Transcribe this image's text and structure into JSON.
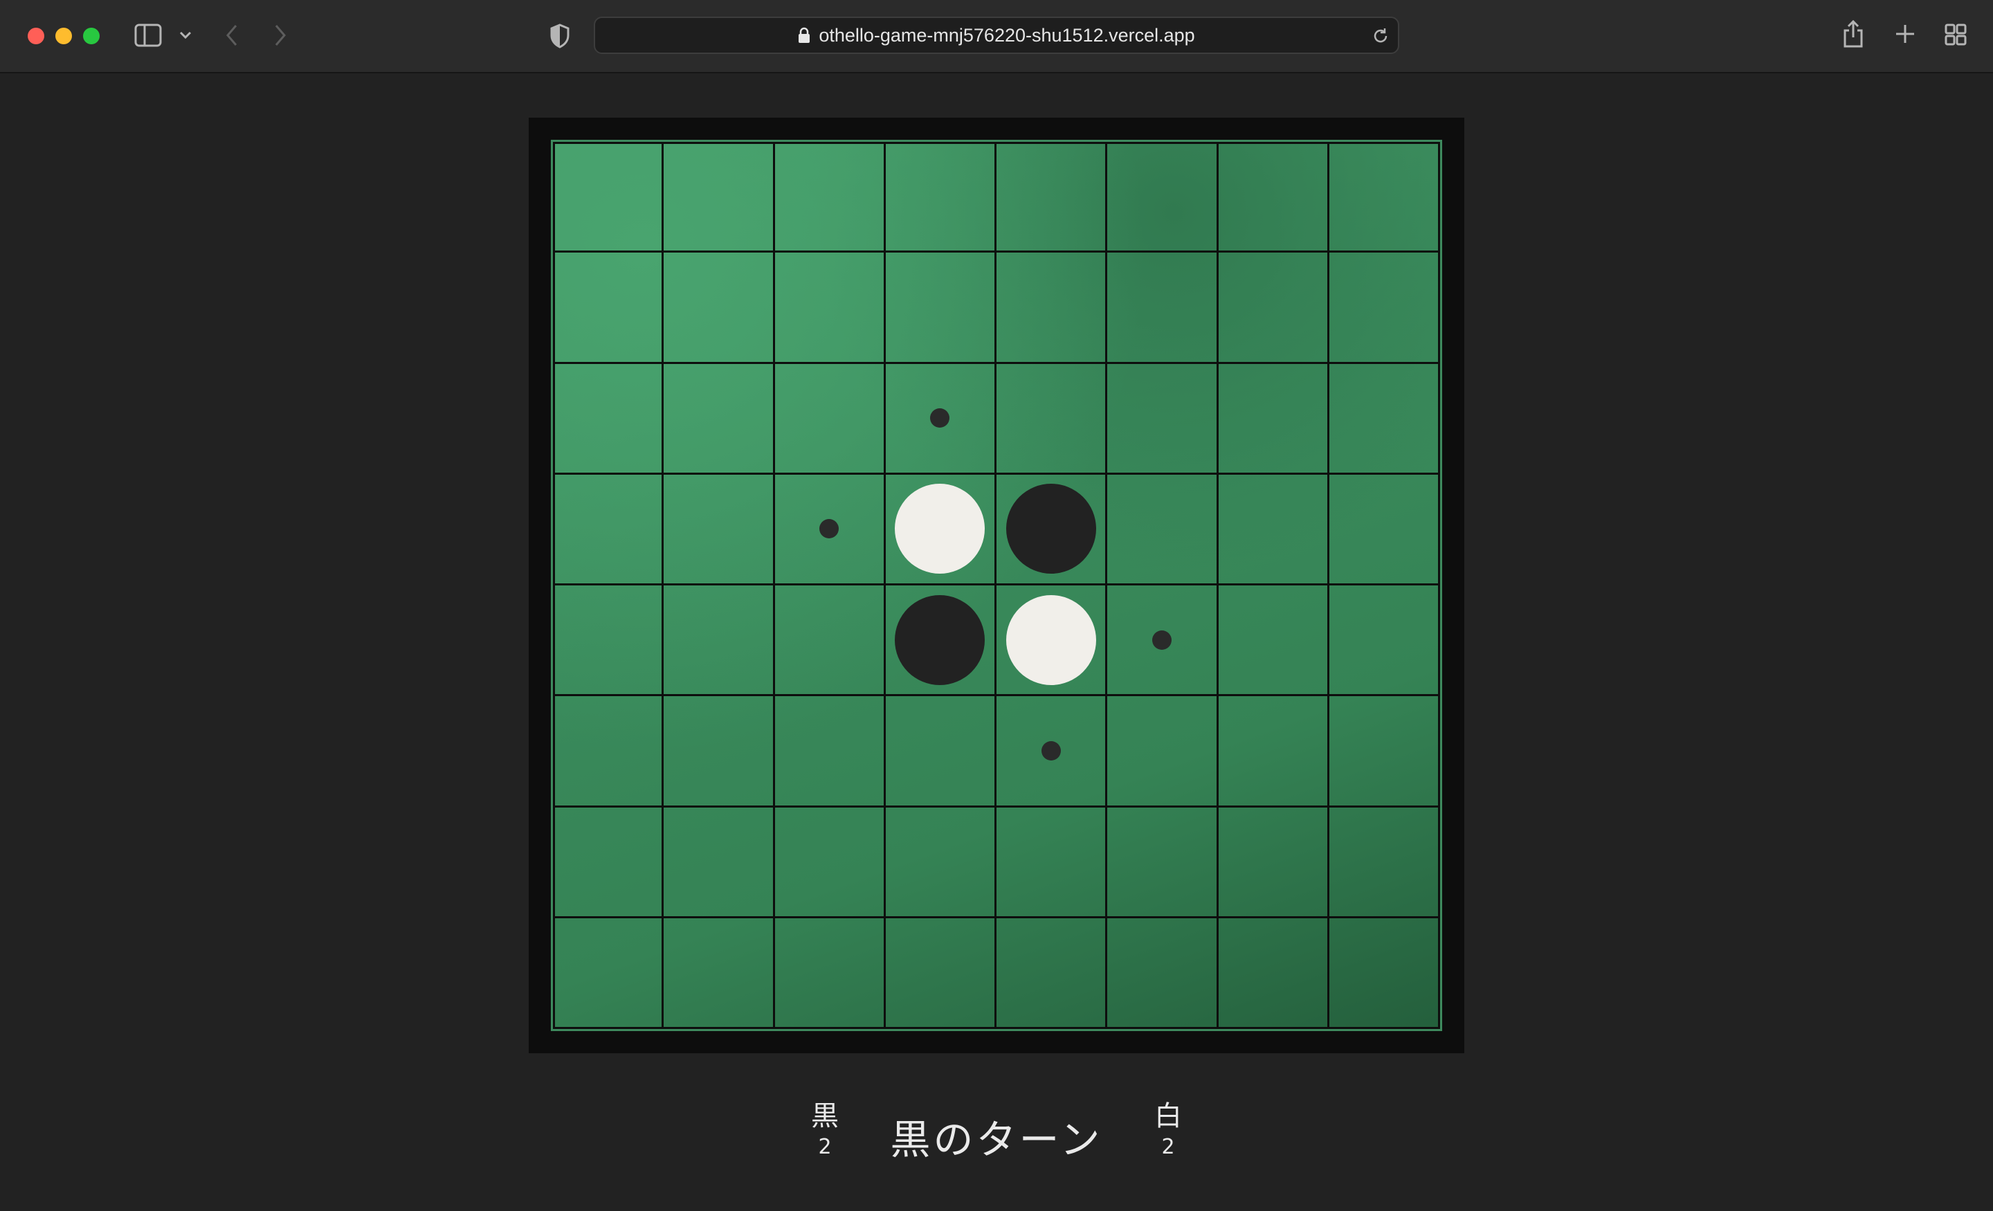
{
  "browser": {
    "url": "othello-game-mnj576220-shu1512.vercel.app",
    "icons": [
      "sidebar-icon",
      "chevron-down-icon",
      "back-icon",
      "forward-icon",
      "shield-icon",
      "lock-icon",
      "reload-icon",
      "share-icon",
      "plus-icon",
      "tab-overview-icon"
    ]
  },
  "game": {
    "board_size": 8,
    "board": [
      [
        "",
        "",
        "",
        "",
        "",
        "",
        "",
        ""
      ],
      [
        "",
        "",
        "",
        "",
        "",
        "",
        "",
        ""
      ],
      [
        "",
        "",
        "",
        "hint",
        "",
        "",
        "",
        ""
      ],
      [
        "",
        "",
        "hint",
        "white",
        "black",
        "",
        "",
        ""
      ],
      [
        "",
        "",
        "",
        "black",
        "white",
        "hint",
        "",
        ""
      ],
      [
        "",
        "",
        "",
        "",
        "hint",
        "",
        "",
        ""
      ],
      [
        "",
        "",
        "",
        "",
        "",
        "",
        "",
        ""
      ],
      [
        "",
        "",
        "",
        "",
        "",
        "",
        "",
        ""
      ]
    ],
    "colors": {
      "board_green": "#3a8b5c",
      "black_disc": "#222222",
      "white_disc": "#f1efea",
      "background": "#222222"
    }
  },
  "status": {
    "black_label": "黒",
    "black_count": "2",
    "turn_text": "黒のターン",
    "white_label": "白",
    "white_count": "2"
  }
}
